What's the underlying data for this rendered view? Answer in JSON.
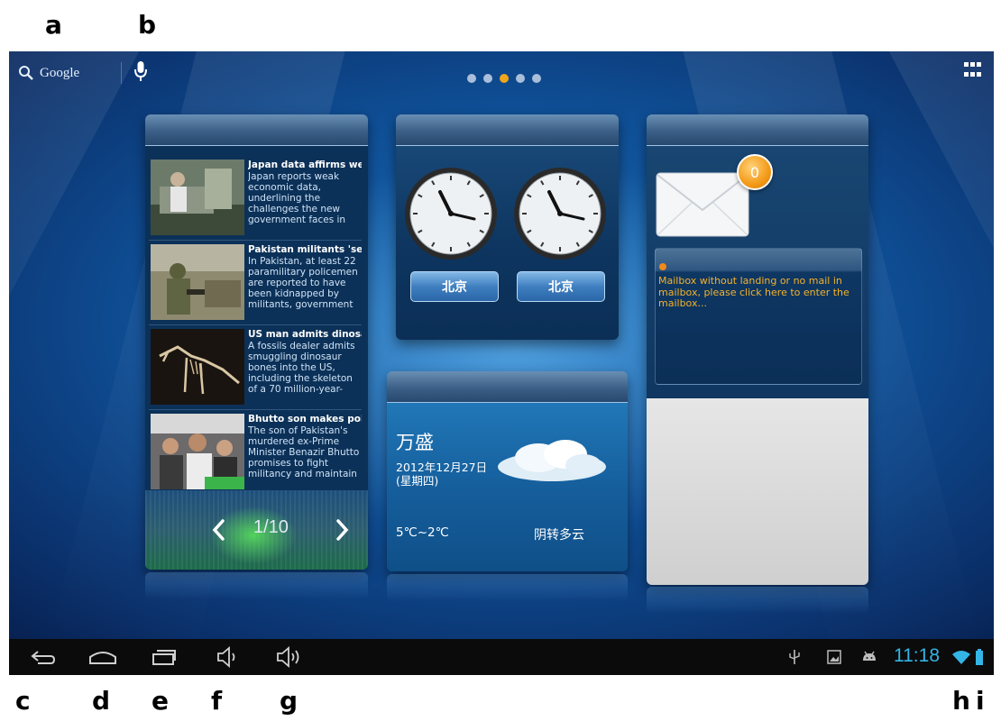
{
  "annotations": [
    "a",
    "b",
    "c",
    "d",
    "e",
    "f",
    "g",
    "h",
    "i"
  ],
  "top_bar": {
    "search_label": "Google",
    "page_dots": 5,
    "active_page": 3
  },
  "news": {
    "items": [
      {
        "title": "Japan data affirms wea",
        "summary": "Japan reports weak economic data, underlining the challenges the new government faces in"
      },
      {
        "title": "Pakistan militants 'sei",
        "summary": "In Pakistan, at least 22 paramilitary policemen are reported to have been kidnapped by militants, government"
      },
      {
        "title": "US man admits dinosau",
        "summary": "A fossils dealer admits smuggling dinosaur bones into the US, including the skeleton of a 70 million-year-"
      },
      {
        "title": "Bhutto son makes polit",
        "summary": "The son of Pakistan's murdered ex-Prime Minister Benazir Bhutto promises to fight militancy and maintain"
      }
    ],
    "pager": "1/10"
  },
  "clocks": {
    "city_left": "北京",
    "city_right": "北京"
  },
  "weather": {
    "city": "万盛",
    "date": "2012年12月27日",
    "weekday": "(星期四)",
    "temp": "5℃~2℃",
    "condition": "阴转多云"
  },
  "mail": {
    "unread_count": "0",
    "notice": "Mailbox without landing or no mail in mailbox, please click here to enter the mailbox..."
  },
  "status_bar": {
    "time": "11:18"
  },
  "colors": {
    "accent_orange": "#f0a51b",
    "clock_blue": "#33b5e5",
    "mail_text": "#f5b22a"
  }
}
